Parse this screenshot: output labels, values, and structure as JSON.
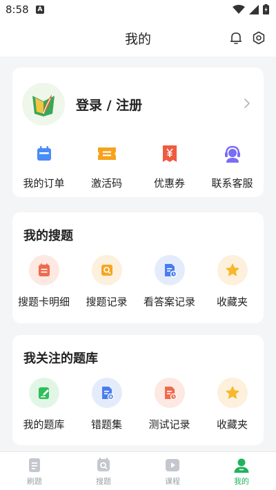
{
  "status": {
    "time": "8:58",
    "badge": "A"
  },
  "header": {
    "title": "我的"
  },
  "profile": {
    "login_text": "登录 / 注册"
  },
  "quick_actions": [
    {
      "label": "我的订单",
      "icon": "calendar-icon"
    },
    {
      "label": "激活码",
      "icon": "ticket-icon"
    },
    {
      "label": "优惠券",
      "icon": "yen-coupon-icon"
    },
    {
      "label": "联系客服",
      "icon": "headset-icon"
    }
  ],
  "search_section": {
    "title": "我的搜题",
    "items": [
      {
        "label": "搜题卡明细",
        "icon": "card-detail-icon"
      },
      {
        "label": "搜题记录",
        "icon": "search-record-icon"
      },
      {
        "label": "看答案记录",
        "icon": "answer-record-icon"
      },
      {
        "label": "收藏夹",
        "icon": "star-icon"
      }
    ]
  },
  "bank_section": {
    "title": "我关注的题库",
    "items": [
      {
        "label": "我的题库",
        "icon": "edit-doc-icon"
      },
      {
        "label": "错题集",
        "icon": "wrong-doc-icon"
      },
      {
        "label": "测试记录",
        "icon": "test-record-icon"
      },
      {
        "label": "收藏夹",
        "icon": "star-icon"
      }
    ]
  },
  "tabbar": [
    {
      "label": "刷题",
      "active": false
    },
    {
      "label": "搜题",
      "active": false
    },
    {
      "label": "课程",
      "active": false
    },
    {
      "label": "我的",
      "active": true
    }
  ],
  "colors": {
    "accent": "#1fb35c",
    "blue": "#4a8cf7",
    "orange": "#f7a21b",
    "red": "#ef5b40",
    "purple": "#7b6cf6"
  }
}
